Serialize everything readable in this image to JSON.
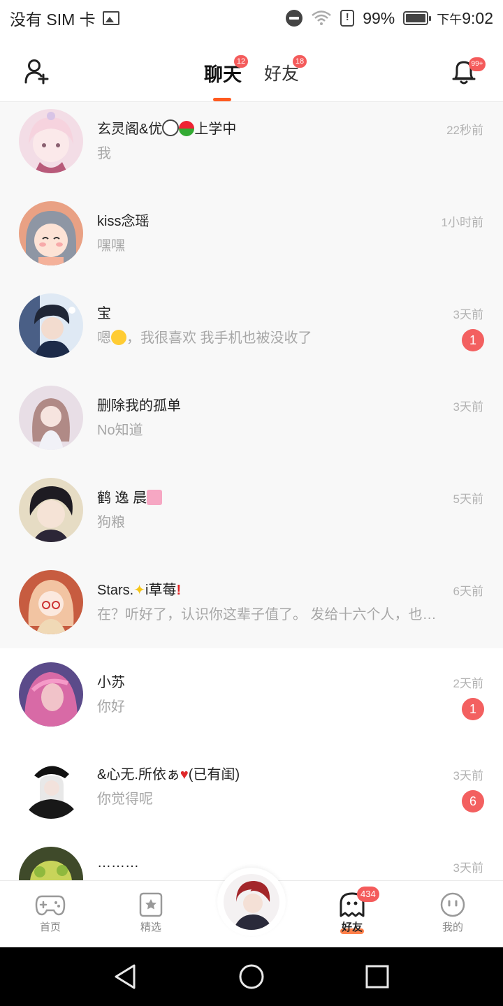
{
  "status_bar": {
    "carrier": "没有 SIM 卡",
    "battery": "99%",
    "time_prefix": "下午",
    "time": "9:02",
    "icons": [
      "image-icon",
      "do-not-disturb-icon",
      "wifi-icon",
      "alert-icon",
      "battery-icon"
    ]
  },
  "header": {
    "tabs": [
      {
        "label": "聊天",
        "badge": "12",
        "active": true
      },
      {
        "label": "好友",
        "badge": "18",
        "active": false
      }
    ],
    "bell_badge": "99+",
    "accent_color": "#ff5a1f"
  },
  "conversations": [
    {
      "name": "玄灵阁&优",
      "name_suffix": "上学中",
      "preview": "我",
      "time": "22秒前",
      "unread": null,
      "pinned": true
    },
    {
      "name": "kiss念瑶",
      "preview": "嘿嘿",
      "time": "1小时前",
      "unread": null,
      "pinned": true
    },
    {
      "name": "宝",
      "preview": "嗯",
      "preview_suffix": "，我很喜欢 我手机也被没收了",
      "time": "3天前",
      "unread": "1",
      "pinned": true
    },
    {
      "name": "删除我的孤单",
      "preview": "No知道",
      "time": "3天前",
      "unread": null,
      "pinned": true
    },
    {
      "name": "鹤 逸 晨",
      "preview": "狗粮",
      "time": "5天前",
      "unread": null,
      "pinned": true
    },
    {
      "name": "Stars.",
      "name_suffix": "i草莓",
      "preview": "在？听好了，认识你这辈子值了。 发给十六个人，也包…",
      "time": "6天前",
      "unread": null,
      "pinned": true
    },
    {
      "name": "小苏",
      "preview": "你好",
      "time": "2天前",
      "unread": "1",
      "pinned": false
    },
    {
      "name": "&心无.所依ぁ",
      "name_suffix": "(已有闺)",
      "preview": "你觉得呢",
      "time": "3天前",
      "unread": "6",
      "pinned": false
    },
    {
      "name": "………",
      "preview": "",
      "time": "3天前",
      "unread": null,
      "pinned": false
    }
  ],
  "bottom_nav": {
    "items": [
      {
        "label": "首页",
        "icon": "gamepad-icon"
      },
      {
        "label": "精选",
        "icon": "star-card-icon"
      },
      {
        "label": "好友",
        "icon": "ghost-icon",
        "badge": "434",
        "active": true
      },
      {
        "label": "我的",
        "icon": "face-icon"
      }
    ]
  }
}
